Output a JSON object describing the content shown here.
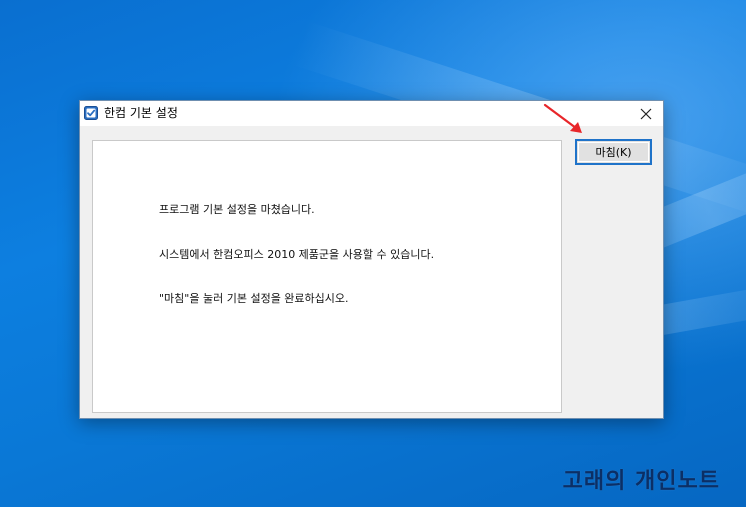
{
  "window": {
    "title": "한컴 기본 설정",
    "icon": "checkbox-app-icon",
    "close_icon": "close-icon"
  },
  "messages": [
    "프로그램 기본 설정을 마쳤습니다.",
    "시스템에서 한컴오피스 2010 제품군을 사용할 수 있습니다.",
    "\"마침\"을 눌러 기본 설정을 완료하십시오."
  ],
  "buttons": {
    "finish_label": "마침(K)"
  },
  "annotation": {
    "arrow_color": "#e8262a"
  },
  "watermark": {
    "text": "고래의 개인노트"
  },
  "colors": {
    "accent": "#1f73c9",
    "desktop": "#0a78d6"
  }
}
